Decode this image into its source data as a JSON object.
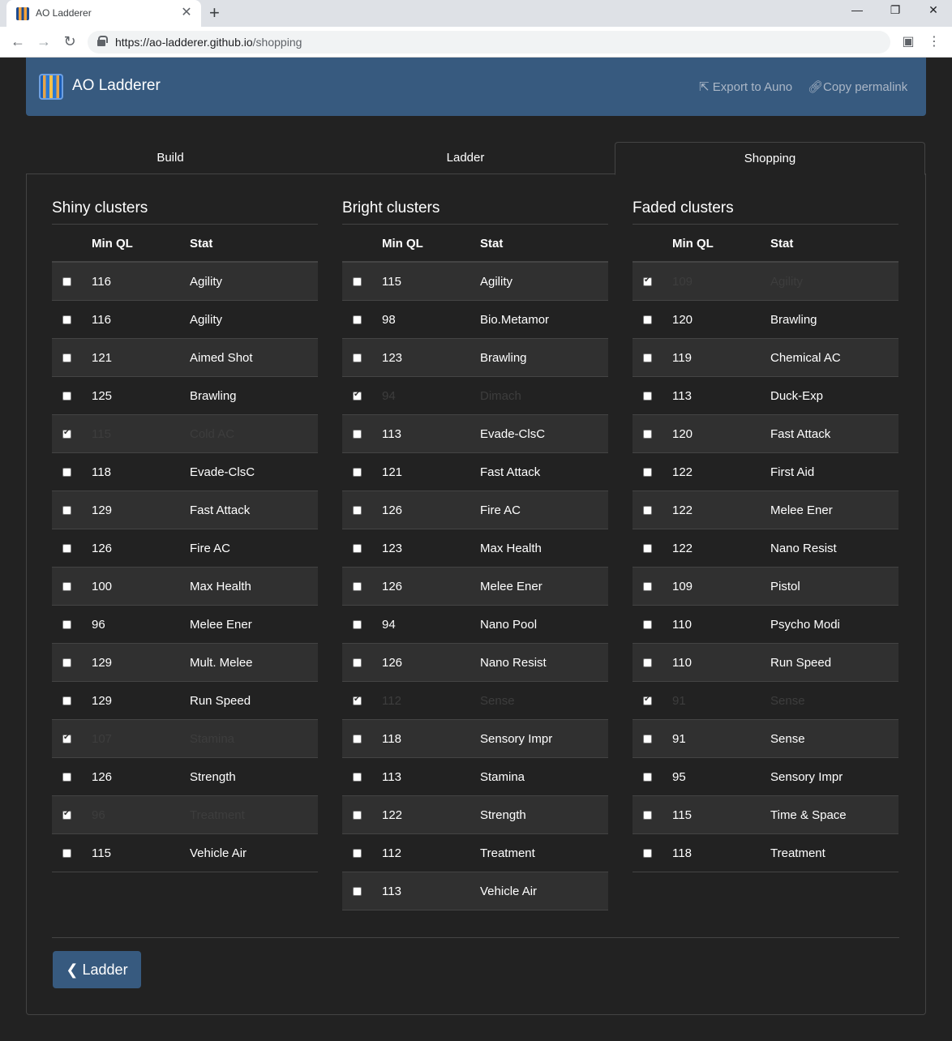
{
  "browser": {
    "tab_title": "AO Ladderer",
    "url_host": "https://ao-ladderer.github.io",
    "url_path": "/shopping"
  },
  "app": {
    "brand": "AO Ladderer",
    "export_label": "Export to Auno",
    "permalink_label": "Copy permalink",
    "tabs": [
      "Build",
      "Ladder",
      "Shopping"
    ],
    "active_tab": "Shopping",
    "back_label": "Ladder",
    "colors": {
      "navbar": "#375a7f",
      "background": "#222222",
      "row_alt": "#303030"
    }
  },
  "columns": [
    {
      "title": "Shiny clusters",
      "header_ql": "Min QL",
      "header_stat": "Stat",
      "rows": [
        {
          "checked": false,
          "ql": "116",
          "stat": "Agility"
        },
        {
          "checked": false,
          "ql": "116",
          "stat": "Agility"
        },
        {
          "checked": false,
          "ql": "121",
          "stat": "Aimed Shot"
        },
        {
          "checked": false,
          "ql": "125",
          "stat": "Brawling"
        },
        {
          "checked": true,
          "ql": "115",
          "stat": "Cold AC"
        },
        {
          "checked": false,
          "ql": "118",
          "stat": "Evade-ClsC"
        },
        {
          "checked": false,
          "ql": "129",
          "stat": "Fast Attack"
        },
        {
          "checked": false,
          "ql": "126",
          "stat": "Fire AC"
        },
        {
          "checked": false,
          "ql": "100",
          "stat": "Max Health"
        },
        {
          "checked": false,
          "ql": "96",
          "stat": "Melee Ener"
        },
        {
          "checked": false,
          "ql": "129",
          "stat": "Mult. Melee"
        },
        {
          "checked": false,
          "ql": "129",
          "stat": "Run Speed"
        },
        {
          "checked": true,
          "ql": "107",
          "stat": "Stamina"
        },
        {
          "checked": false,
          "ql": "126",
          "stat": "Strength"
        },
        {
          "checked": true,
          "ql": "96",
          "stat": "Treatment"
        },
        {
          "checked": false,
          "ql": "115",
          "stat": "Vehicle Air"
        }
      ]
    },
    {
      "title": "Bright clusters",
      "header_ql": "Min QL",
      "header_stat": "Stat",
      "rows": [
        {
          "checked": false,
          "ql": "115",
          "stat": "Agility"
        },
        {
          "checked": false,
          "ql": "98",
          "stat": "Bio.Metamor"
        },
        {
          "checked": false,
          "ql": "123",
          "stat": "Brawling"
        },
        {
          "checked": true,
          "ql": "94",
          "stat": "Dimach"
        },
        {
          "checked": false,
          "ql": "113",
          "stat": "Evade-ClsC"
        },
        {
          "checked": false,
          "ql": "121",
          "stat": "Fast Attack"
        },
        {
          "checked": false,
          "ql": "126",
          "stat": "Fire AC"
        },
        {
          "checked": false,
          "ql": "123",
          "stat": "Max Health"
        },
        {
          "checked": false,
          "ql": "126",
          "stat": "Melee Ener"
        },
        {
          "checked": false,
          "ql": "94",
          "stat": "Nano Pool"
        },
        {
          "checked": false,
          "ql": "126",
          "stat": "Nano Resist"
        },
        {
          "checked": true,
          "ql": "112",
          "stat": "Sense"
        },
        {
          "checked": false,
          "ql": "118",
          "stat": "Sensory Impr"
        },
        {
          "checked": false,
          "ql": "113",
          "stat": "Stamina"
        },
        {
          "checked": false,
          "ql": "122",
          "stat": "Strength"
        },
        {
          "checked": false,
          "ql": "112",
          "stat": "Treatment"
        },
        {
          "checked": false,
          "ql": "113",
          "stat": "Vehicle Air"
        }
      ]
    },
    {
      "title": "Faded clusters",
      "header_ql": "Min QL",
      "header_stat": "Stat",
      "rows": [
        {
          "checked": true,
          "ql": "109",
          "stat": "Agility"
        },
        {
          "checked": false,
          "ql": "120",
          "stat": "Brawling"
        },
        {
          "checked": false,
          "ql": "119",
          "stat": "Chemical AC"
        },
        {
          "checked": false,
          "ql": "113",
          "stat": "Duck-Exp"
        },
        {
          "checked": false,
          "ql": "120",
          "stat": "Fast Attack"
        },
        {
          "checked": false,
          "ql": "122",
          "stat": "First Aid"
        },
        {
          "checked": false,
          "ql": "122",
          "stat": "Melee Ener"
        },
        {
          "checked": false,
          "ql": "122",
          "stat": "Nano Resist"
        },
        {
          "checked": false,
          "ql": "109",
          "stat": "Pistol"
        },
        {
          "checked": false,
          "ql": "110",
          "stat": "Psycho Modi"
        },
        {
          "checked": false,
          "ql": "110",
          "stat": "Run Speed"
        },
        {
          "checked": true,
          "ql": "91",
          "stat": "Sense"
        },
        {
          "checked": false,
          "ql": "91",
          "stat": "Sense"
        },
        {
          "checked": false,
          "ql": "95",
          "stat": "Sensory Impr"
        },
        {
          "checked": false,
          "ql": "115",
          "stat": "Time & Space"
        },
        {
          "checked": false,
          "ql": "118",
          "stat": "Treatment"
        }
      ]
    }
  ]
}
